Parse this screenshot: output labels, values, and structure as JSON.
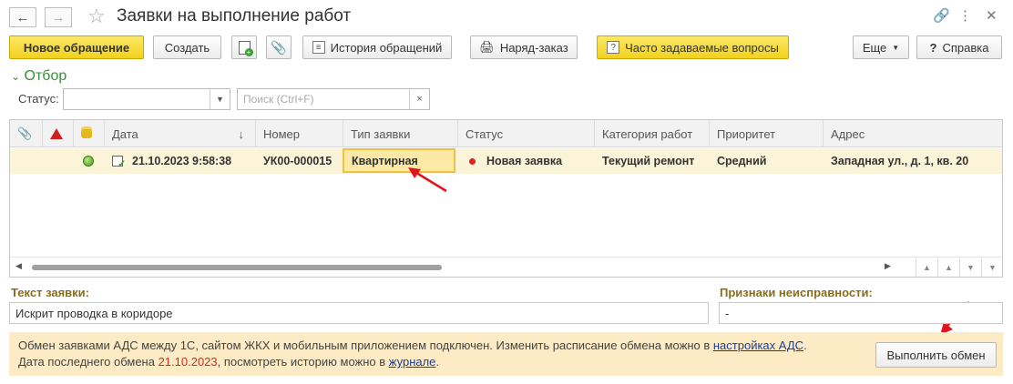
{
  "window": {
    "title": "Заявки на выполнение работ"
  },
  "toolbar": {
    "new_request": "Новое обращение",
    "create": "Создать",
    "history": "История обращений",
    "work_order": "Наряд-заказ",
    "faq": "Часто задаваемые вопросы",
    "more": "Еще",
    "help": "Справка"
  },
  "filter": {
    "header": "Отбор",
    "status_label": "Статус:",
    "status_value": "",
    "search_placeholder": "Поиск (Ctrl+F)"
  },
  "grid": {
    "columns": [
      "Дата",
      "Номер",
      "Тип заявки",
      "Статус",
      "Категория работ",
      "Приоритет",
      "Адрес"
    ],
    "rows": [
      {
        "date": "21.10.2023 9:58:38",
        "number": "УК00-000015",
        "type": "Квартирная",
        "status": "Новая заявка",
        "category": "Текущий ремонт",
        "priority": "Средний",
        "address": "Западная ул., д. 1, кв. 20"
      }
    ]
  },
  "details": {
    "text_label": "Текст заявки:",
    "text_value": "Искрит проводка в коридоре",
    "signs_label": "Признаки неисправности:",
    "signs_value": "-"
  },
  "info": {
    "line1_pre": "Обмен заявками АДС между 1С, сайтом ЖКХ и мобильным приложением подключен. Изменить расписание обмена можно в ",
    "line1_link": "настройках АДС",
    "line1_post": ".",
    "line2_pre": "Дата последнего обмена ",
    "line2_date": "21.10.2023",
    "line2_mid": ", посмотреть историю можно в ",
    "line2_link": "журнале",
    "line2_post": ".",
    "exchange_button": "Выполнить обмен"
  },
  "colors": {
    "accent_yellow": "#f2d21e",
    "selected_row": "#fbf4d8",
    "status_dot": "#e02020",
    "annotation_arrow": "#e0141e"
  }
}
